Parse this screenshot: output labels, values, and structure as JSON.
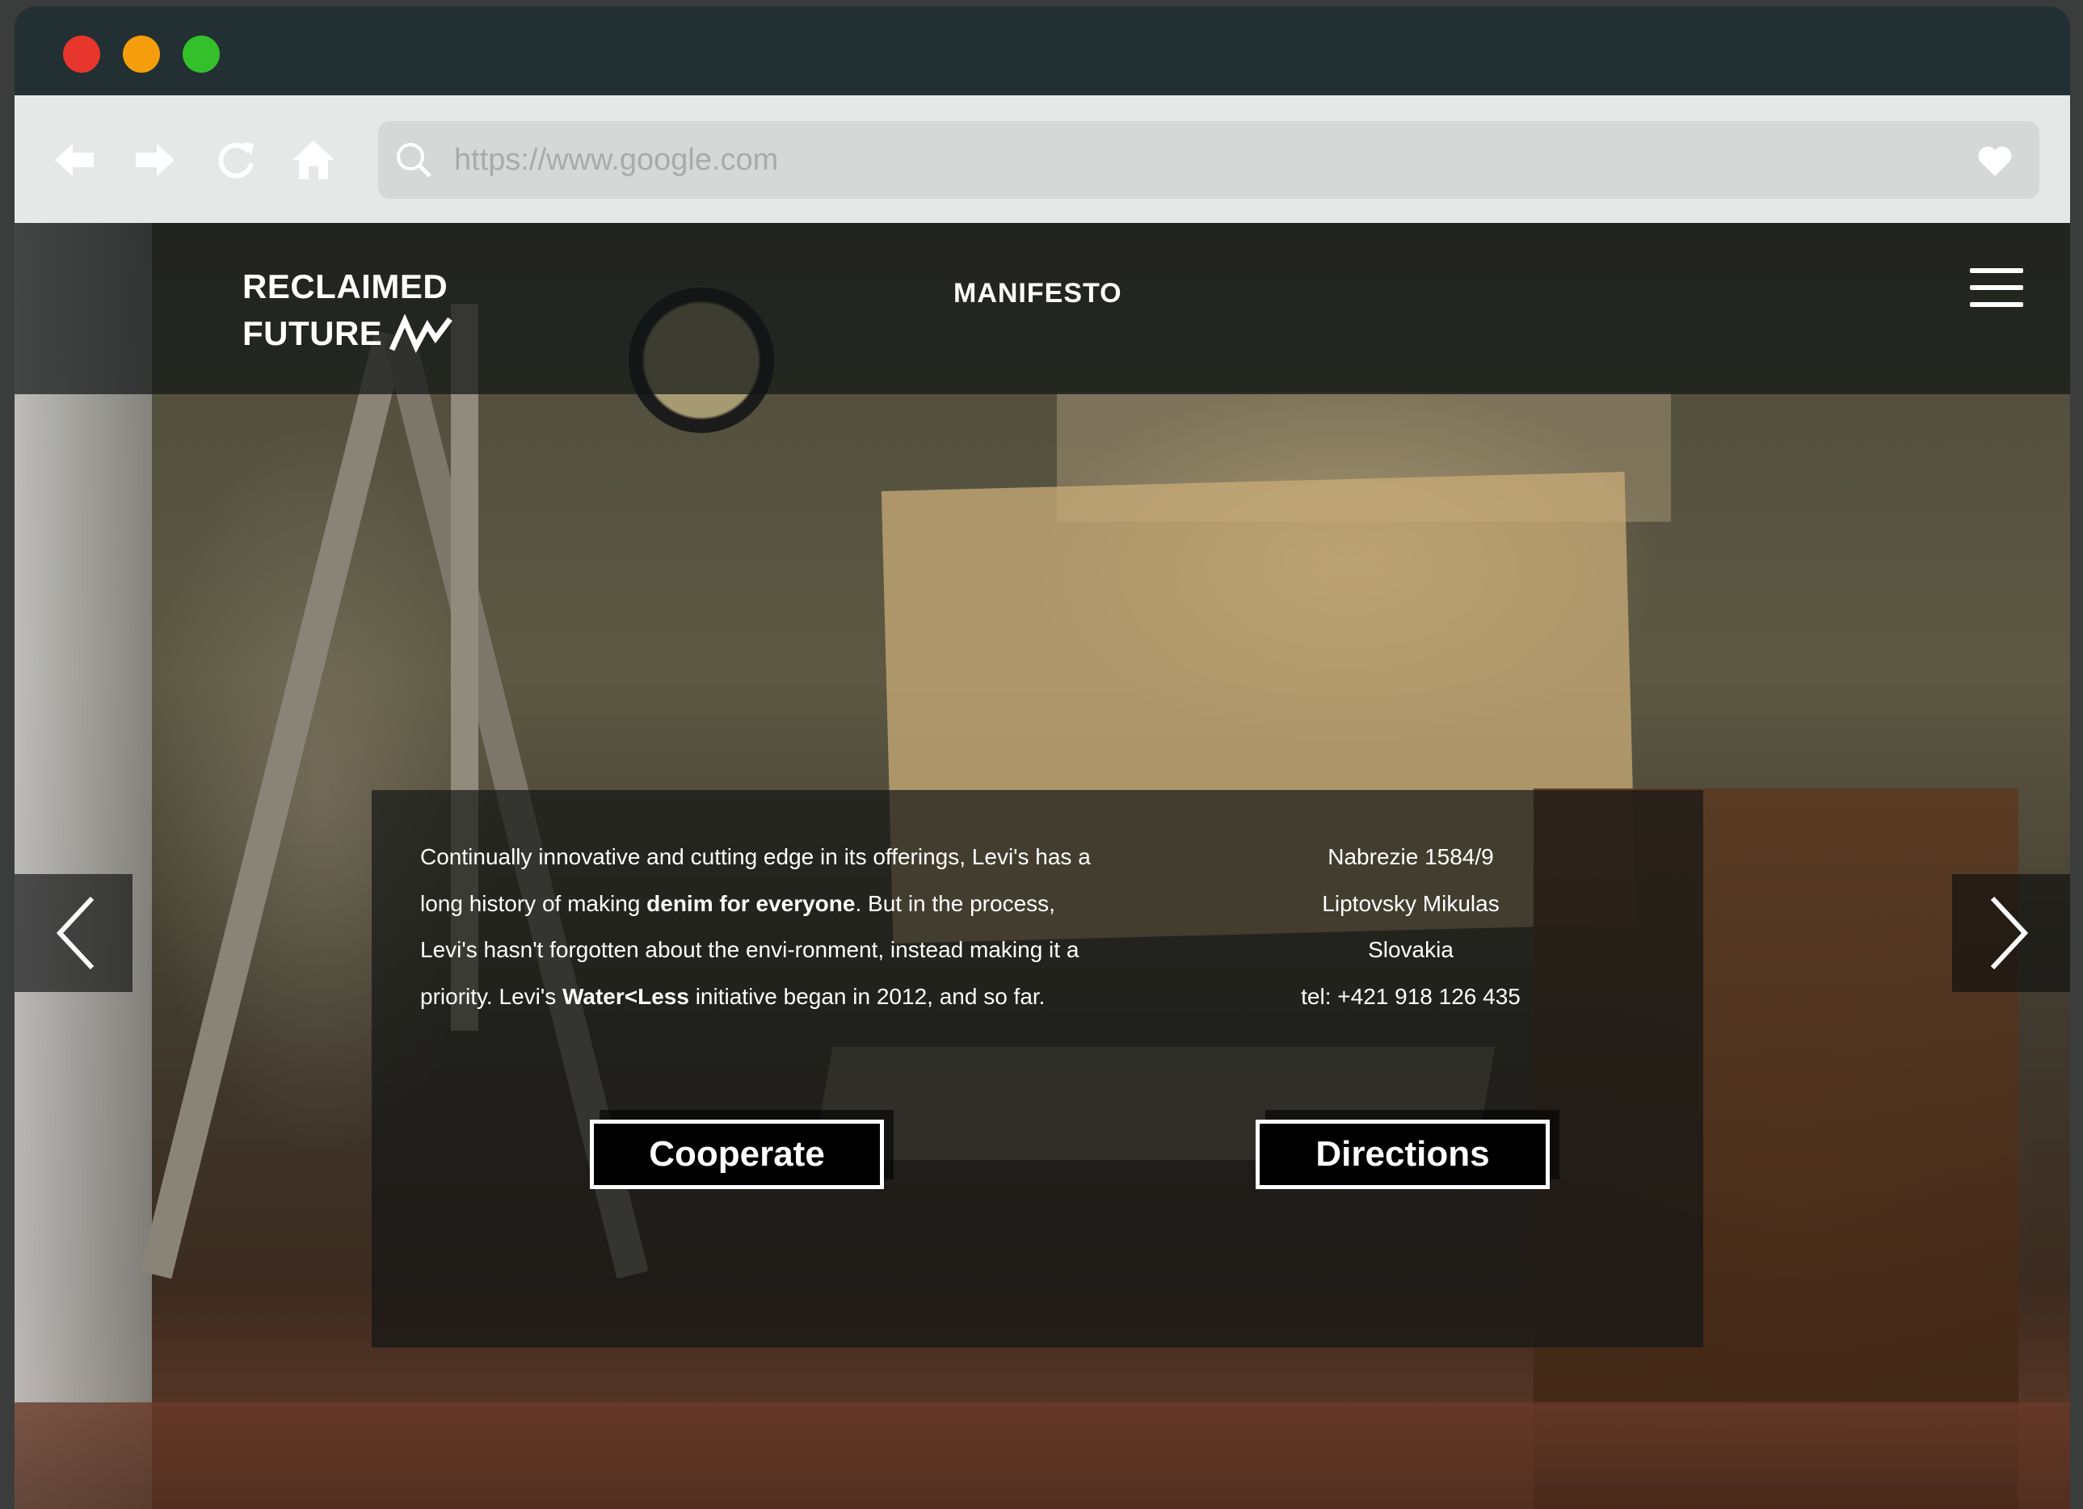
{
  "browser": {
    "url": "https://www.google.com"
  },
  "site": {
    "logo_line1": "RECLAIMED",
    "logo_line2": "FUTURE",
    "nav_manifesto": "MANIFESTO"
  },
  "content": {
    "description_parts": {
      "p1": "Continually innovative and cutting edge in its offerings, Levi's has a long history of making ",
      "b1": "denim for everyone",
      "p2": ". But in the process, Levi's hasn't forgotten about the envi-ronment, instead making it a priority. Levi's ",
      "b2": "Water<Less",
      "p3": " initiative began in 2012, and so far."
    },
    "address": {
      "street": "Nabrezie 1584/9",
      "city": "Liptovsky Mikulas",
      "country": "Slovakia",
      "tel": "tel: +421 918 126 435"
    },
    "buttons": {
      "cooperate": "Cooperate",
      "directions": "Directions"
    }
  },
  "colors": {
    "titlebar": "#223033",
    "toolbar": "#e6e7e7",
    "close": "#e8362c",
    "minimize": "#f59e0b",
    "maximize": "#34c02a"
  },
  "icons": [
    "back-arrow-icon",
    "forward-arrow-icon",
    "reload-icon",
    "home-icon",
    "search-icon",
    "heart-icon",
    "logo-zigzag-icon",
    "hamburger-menu-icon",
    "chevron-left-icon",
    "chevron-right-icon"
  ]
}
